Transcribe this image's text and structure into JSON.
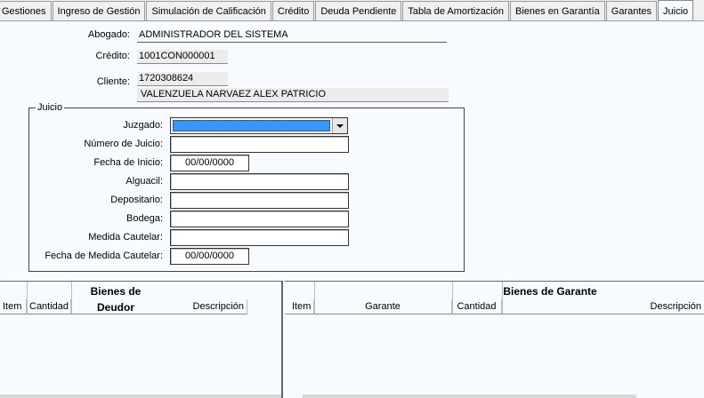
{
  "tabs": [
    {
      "label": "Gestiones",
      "active": false
    },
    {
      "label": "Ingreso de Gestión",
      "active": false
    },
    {
      "label": "Simulación de Calificación",
      "active": false
    },
    {
      "label": "Crédito",
      "active": false
    },
    {
      "label": "Deuda Pendiente",
      "active": false
    },
    {
      "label": "Tabla de Amortización",
      "active": false
    },
    {
      "label": "Bienes en Garantía",
      "active": false
    },
    {
      "label": "Garantes",
      "active": false
    },
    {
      "label": "Juicio",
      "active": true
    }
  ],
  "header": {
    "abogado_label": "Abogado:",
    "abogado_value": "ADMINISTRADOR DEL SISTEMA",
    "credito_label": "Crédito:",
    "credito_value": "1001CON000001",
    "cliente_label": "Cliente:",
    "cliente_id": "1720308624",
    "cliente_name": "VALENZUELA NARVAEZ ALEX PATRICIO"
  },
  "juicio": {
    "group_label": "Juicio",
    "juzgado_label": "Juzgado:",
    "juzgado_value": "",
    "numero_label": "Número de Juicio:",
    "numero_value": "",
    "fecha_inicio_label": "Fecha de Inicio:",
    "fecha_inicio_value": "00/00/0000",
    "alguacil_label": "Alguacil:",
    "alguacil_value": "",
    "depositario_label": "Depositario:",
    "depositario_value": "",
    "bodega_label": "Bodega:",
    "bodega_value": "",
    "medida_label": "Medida Cautelar:",
    "medida_value": "",
    "fecha_medida_label": "Fecha de Medida Cautelar:",
    "fecha_medida_value": "00/00/0000"
  },
  "bienes_deudor": {
    "title": "Bienes de Deudor",
    "columns": [
      "Item",
      "Cantidad",
      "Descripción"
    ]
  },
  "bienes_garante": {
    "title": "Bienes de Garante",
    "columns": [
      "Item",
      "Garante",
      "Cantidad",
      "Descripción"
    ]
  },
  "colors": {
    "background": "#f7fbff",
    "combo_selection": "#3399ff"
  }
}
